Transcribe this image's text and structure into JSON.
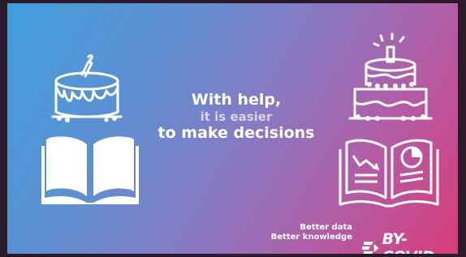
{
  "headline": {
    "line1": "With help,",
    "line2": "it is easier",
    "line3": "to make decisions"
  },
  "tagline": {
    "line1": "Better data",
    "line2": "Better knowledge"
  },
  "logo": {
    "text": "BY-COVID"
  },
  "colors": {
    "gradient_start": "#3f9fdc",
    "gradient_end": "#d93c79",
    "frame": "#2b1a2a",
    "text": "#ffffff"
  },
  "icons": {
    "left": [
      "messy-cake-icon",
      "open-book-icon"
    ],
    "right": [
      "layered-cake-icon",
      "open-book-with-charts-icon"
    ]
  }
}
